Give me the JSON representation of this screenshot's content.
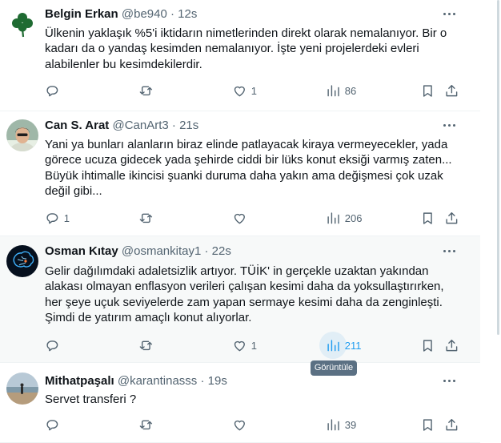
{
  "tweets": [
    {
      "name": "Belgin Erkan",
      "handle": "@be940",
      "sep": "·",
      "time": "12s",
      "text": "Ülkenin yaklaşık %5'i iktidarın nimetlerinden direkt olarak nemalanıyor. Bir o\nkadarı da o yandaş kesimden nemalanıyor. İşte yeni projelerdeki evleri\nalabilenler bu kesimdekilerdir.",
      "replies": "",
      "retweets": "",
      "likes": "1",
      "views": "86",
      "avatar_icon": "clover-icon"
    },
    {
      "name": "Can S. Arat",
      "handle": "@CanArt3",
      "sep": "·",
      "time": "21s",
      "text": "Yani ya bunları alanların biraz elinde patlayacak kiraya vermeyecekler, yada\ngörece ucuza gidecek yada şehirde ciddi bir lüks konut eksiği varmış zaten...\nBüyük ihtimalle ikincisi şuanki duruma daha yakın ama değişmesi çok uzak\ndeğil gibi...",
      "replies": "1",
      "retweets": "",
      "likes": "",
      "views": "206",
      "avatar_icon": "person-photo"
    },
    {
      "name": "Osman Kıtay",
      "handle": "@osmankitay1",
      "sep": "·",
      "time": "22s",
      "text": "Gelir dağılımdaki adaletsizlik artıyor. TÜİK' in gerçekle uzaktan yakından\nalakası olmayan enflasyon verileri çalışan kesimi daha da yoksullaştırırken,\nher şeye uçuk seviyelerde zam yapan sermaye kesimi daha da zenginleşti.\nŞimdi de yatırım amaçlı konut alıyorlar.",
      "replies": "",
      "retweets": "",
      "likes": "1",
      "views": "211",
      "avatar_icon": "neon-brain-image"
    },
    {
      "name": "Mithatpaşalı",
      "handle": "@karantinasss",
      "sep": "·",
      "time": "19s",
      "text": "Servet transferi ?",
      "replies": "",
      "retweets": "",
      "likes": "",
      "views": "39",
      "avatar_icon": "beach-photo"
    }
  ],
  "tooltip": "Görüntüle",
  "colors": {
    "text": "#0f1419",
    "secondary": "#536471",
    "accent": "#1d9bf0",
    "divider": "#eff3f4",
    "hover_bg": "#f7f9f9",
    "tooltip_bg": "#5b7083"
  },
  "icons": [
    "reply-icon",
    "retweet-icon",
    "like-icon",
    "views-icon",
    "bookmark-icon",
    "share-icon",
    "more-icon"
  ]
}
